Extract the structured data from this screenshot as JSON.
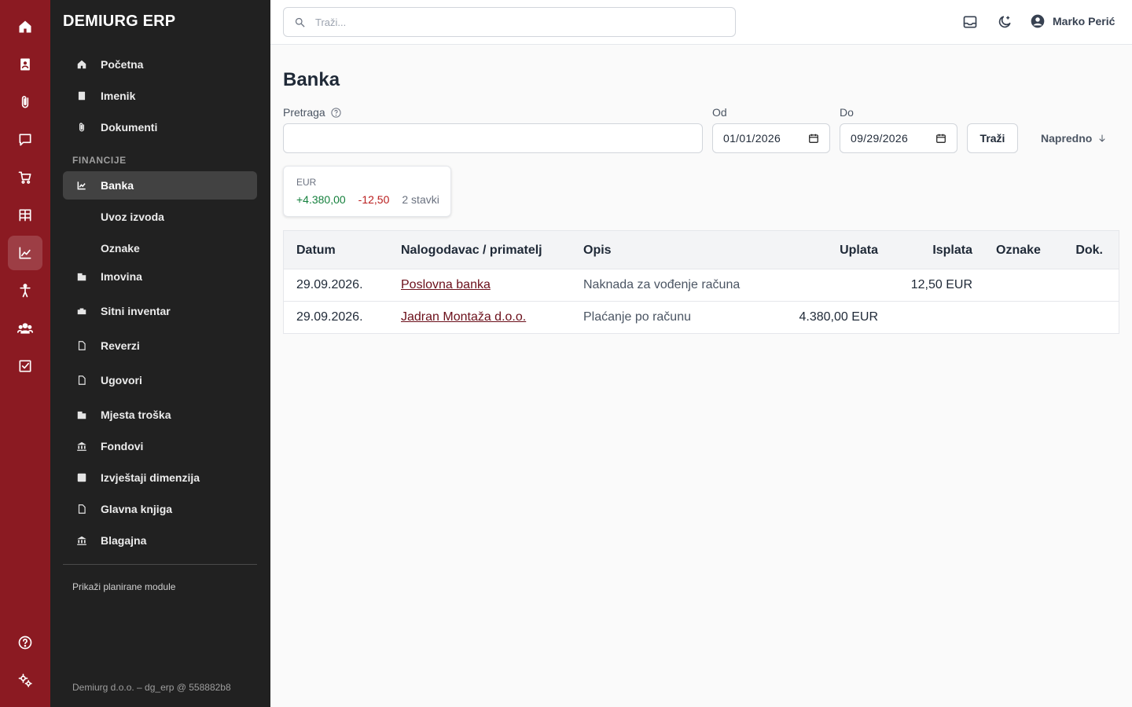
{
  "app": {
    "brand": "DEMIURG ERP"
  },
  "rail": {
    "icons": [
      "home-icon",
      "contacts-book-icon",
      "paperclip-icon",
      "chat-box-icon",
      "cart-icon",
      "warehouse-shelves-icon",
      "chart-icon",
      "person-icon",
      "users-icon",
      "checkbox-icon",
      "help-icon",
      "settings-icon"
    ],
    "active": "chart-icon"
  },
  "sidebar": {
    "top_items": [
      {
        "label": "Početna",
        "icon": "home-icon"
      },
      {
        "label": "Imenik",
        "icon": "contacts-book-icon"
      },
      {
        "label": "Dokumenti",
        "icon": "paperclip-icon"
      }
    ],
    "section_label": "FINANCIJE",
    "finance_items": [
      {
        "label": "Banka",
        "icon": "chart-icon",
        "active": true
      },
      {
        "label": "Uvoz izvoda"
      },
      {
        "label": "Oznake"
      },
      {
        "label": "Imovina",
        "icon": "building-icon"
      },
      {
        "label": "Sitni inventar",
        "icon": "toolbox-icon"
      },
      {
        "label": "Reverzi",
        "icon": "document-icon"
      },
      {
        "label": "Ugovori",
        "icon": "document-icon"
      },
      {
        "label": "Mjesta troška",
        "icon": "building-icon"
      },
      {
        "label": "Fondovi",
        "icon": "bank-icon"
      },
      {
        "label": "Izvještaji dimenzija",
        "icon": "pdf-icon"
      },
      {
        "label": "Glavna knjiga",
        "icon": "document-icon"
      },
      {
        "label": "Blagajna",
        "icon": "bank-icon"
      }
    ],
    "planned_label": "Prikaži planirane module",
    "footer": "Demiurg d.o.o. – dg_erp @ 558882b8"
  },
  "topbar": {
    "search_placeholder": "Traži...",
    "user_name": "Marko Perić"
  },
  "main": {
    "title": "Banka",
    "filters": {
      "search_label": "Pretraga",
      "search_value": "",
      "from_label": "Od",
      "from_value": "01/01/2026",
      "to_label": "Do",
      "to_value": "09/29/2026",
      "search_button": "Traži",
      "advanced_button": "Napredno"
    },
    "summary": {
      "currency": "EUR",
      "income": "+4.380,00",
      "expense": "-12,50",
      "count": "2 stavki"
    },
    "table": {
      "columns": [
        "Datum",
        "Nalogodavac / primatelj",
        "Opis",
        "Uplata",
        "Isplata",
        "Oznake",
        "Dok."
      ],
      "rows": [
        {
          "date": "29.09.2026.",
          "party": "Poslovna banka",
          "description": "Naknada za vođenje računa",
          "income": "",
          "expense": "12,50 EUR",
          "tags": "",
          "doc": ""
        },
        {
          "date": "29.09.2026.",
          "party": "Jadran Montaža d.o.o.",
          "description": "Plaćanje po računu",
          "income": "4.380,00 EUR",
          "expense": "",
          "tags": "",
          "doc": ""
        }
      ]
    }
  },
  "colors": {
    "rail": "#8b1a22",
    "sidebar": "#212121",
    "positive": "#15803d",
    "negative": "#b91c1c",
    "link": "#6b0f1a"
  }
}
